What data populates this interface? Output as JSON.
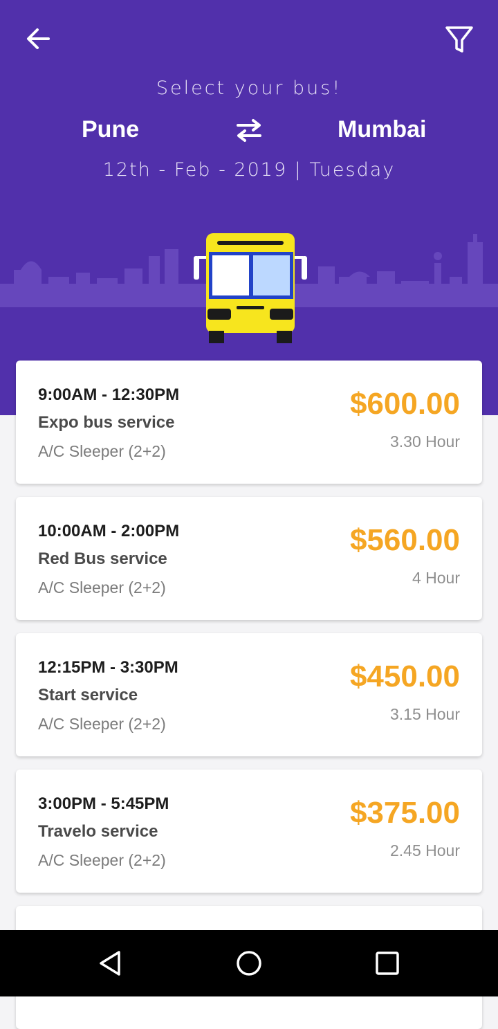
{
  "header": {
    "subtitle": "Select your bus!",
    "from_city": "Pune",
    "to_city": "Mumbai",
    "date_line": "12th - Feb - 2019 | Tuesday",
    "background_color": "#5130ab",
    "icons": {
      "back": "arrow-left-icon",
      "filter": "filter-icon",
      "swap": "swap-arrows-icon",
      "illustration": "bus-front-illustration"
    }
  },
  "buses": [
    {
      "time": "9:00AM - 12:30PM",
      "operator": "Expo bus service",
      "seat": "A/C Sleeper (2+2)",
      "price": "$600.00",
      "duration": "3.30 Hour"
    },
    {
      "time": "10:00AM - 2:00PM",
      "operator": "Red Bus service",
      "seat": "A/C Sleeper (2+2)",
      "price": "$560.00",
      "duration": "4 Hour"
    },
    {
      "time": "12:15PM - 3:30PM",
      "operator": "Start service",
      "seat": "A/C Sleeper (2+2)",
      "price": "$450.00",
      "duration": "3.15 Hour"
    },
    {
      "time": "3:00PM - 5:45PM",
      "operator": "Travelo service",
      "seat": "A/C Sleeper (2+2)",
      "price": "$375.00",
      "duration": "2.45 Hour"
    }
  ],
  "colors": {
    "accent_price": "#f5a623",
    "card_bg": "#ffffff",
    "navbar_bg": "#000000"
  },
  "navbar": {
    "icons": [
      "nav-back-icon",
      "nav-home-icon",
      "nav-recents-icon"
    ]
  }
}
